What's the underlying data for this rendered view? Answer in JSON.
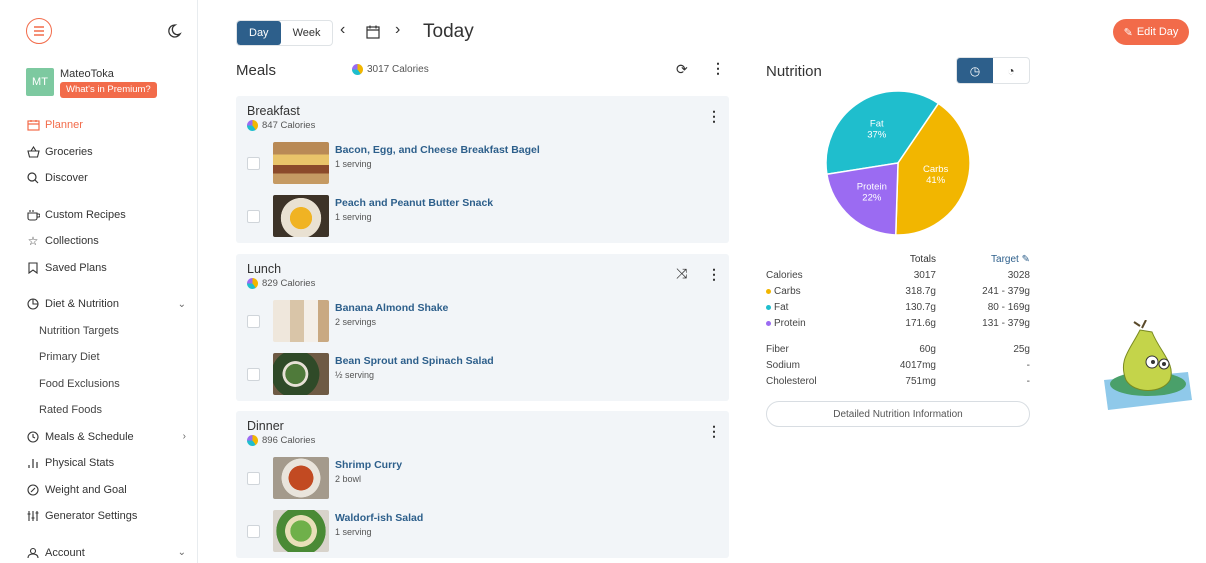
{
  "sidebar": {
    "user": {
      "initials": "MT",
      "name": "MateoToka",
      "premium_label": "What's in Premium?"
    },
    "items": [
      {
        "label": "Planner",
        "icon": "planner-icon"
      },
      {
        "label": "Groceries",
        "icon": "basket-icon"
      },
      {
        "label": "Discover",
        "icon": "search-icon"
      },
      {
        "label": "Custom Recipes",
        "icon": "cup-icon"
      },
      {
        "label": "Collections",
        "icon": "star-icon"
      },
      {
        "label": "Saved Plans",
        "icon": "bookmark-icon"
      },
      {
        "label": "Diet & Nutrition",
        "icon": "pie-icon"
      },
      {
        "label": "Nutrition Targets"
      },
      {
        "label": "Primary Diet"
      },
      {
        "label": "Food Exclusions"
      },
      {
        "label": "Rated Foods"
      },
      {
        "label": "Meals & Schedule",
        "icon": "clock-icon"
      },
      {
        "label": "Physical Stats",
        "icon": "bars-icon"
      },
      {
        "label": "Weight and Goal",
        "icon": "target-icon"
      },
      {
        "label": "Generator Settings",
        "icon": "sliders-icon"
      },
      {
        "label": "Account",
        "icon": "user-icon"
      }
    ]
  },
  "header": {
    "day_label": "Day",
    "week_label": "Week",
    "title": "Today",
    "edit_day_label": "Edit Day"
  },
  "meals": {
    "title": "Meals",
    "total_calories": "3017 Calories",
    "sections": [
      {
        "title": "Breakfast",
        "calories": "847 Calories",
        "foods": [
          {
            "name": "Bacon, Egg, and Cheese Breakfast Bagel",
            "serving": "1 serving"
          },
          {
            "name": "Peach and Peanut Butter Snack",
            "serving": "1 serving"
          }
        ]
      },
      {
        "title": "Lunch",
        "calories": "829 Calories",
        "foods": [
          {
            "name": "Banana Almond Shake",
            "serving": "2 servings"
          },
          {
            "name": "Bean Sprout and Spinach Salad",
            "serving": "½ serving"
          }
        ]
      },
      {
        "title": "Dinner",
        "calories": "896 Calories",
        "foods": [
          {
            "name": "Shrimp Curry",
            "serving": "2 bowl"
          },
          {
            "name": "Waldorf-ish Salad",
            "serving": "1 serving"
          }
        ]
      }
    ]
  },
  "nutrition": {
    "title": "Nutrition",
    "pie": {
      "slices": [
        {
          "name": "Fat",
          "value": 37,
          "label": "37%",
          "color": "#1fbecd"
        },
        {
          "name": "Carbs",
          "value": 41,
          "label": "41%",
          "color": "#f2b600"
        },
        {
          "name": "Protein",
          "value": 22,
          "label": "22%",
          "color": "#9b6bf2"
        }
      ]
    },
    "col_totals": "Totals",
    "col_target": "Target",
    "rows": [
      {
        "label": "Calories",
        "total": "3017",
        "target": "3028"
      },
      {
        "label": "Carbs",
        "total": "318.7g",
        "target": "241 - 379g",
        "color": "#f2b600"
      },
      {
        "label": "Fat",
        "total": "130.7g",
        "target": "80 - 169g",
        "color": "#1fbecd"
      },
      {
        "label": "Protein",
        "total": "171.6g",
        "target": "131 - 379g",
        "color": "#9b6bf2"
      },
      {
        "label": "Fiber",
        "total": "60g",
        "target": "25g"
      },
      {
        "label": "Sodium",
        "total": "4017mg",
        "target": "-"
      },
      {
        "label": "Cholesterol",
        "total": "751mg",
        "target": "-"
      }
    ],
    "detail_label": "Detailed Nutrition Information"
  },
  "colors": {
    "accent": "#f26b4a",
    "primary": "#2d5f8b"
  }
}
